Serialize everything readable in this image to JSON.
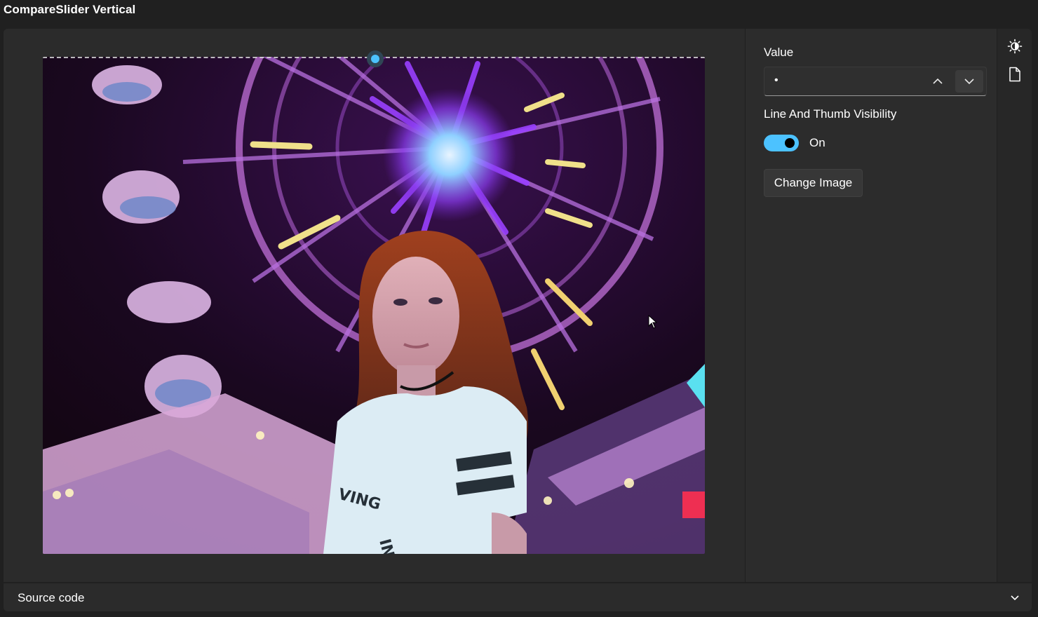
{
  "page": {
    "title": "CompareSlider Vertical"
  },
  "compare_slider": {
    "orientation": "vertical",
    "value_fraction": 0.0,
    "line_visible": true,
    "image_description_icon": "ferris-wheel-photo"
  },
  "options": {
    "value_label": "Value",
    "value_text": "•",
    "line_thumb_label": "Line And Thumb Visibility",
    "toggle_state": "On",
    "change_image_label": "Change Image"
  },
  "toolbar": {
    "theme_icon": "theme-toggle-icon",
    "source_icon": "document-icon"
  },
  "source_code": {
    "label": "Source code",
    "expanded": false
  },
  "colors": {
    "accent": "#4cc2ff",
    "background": "#202020",
    "card": "#2b2b2b"
  }
}
